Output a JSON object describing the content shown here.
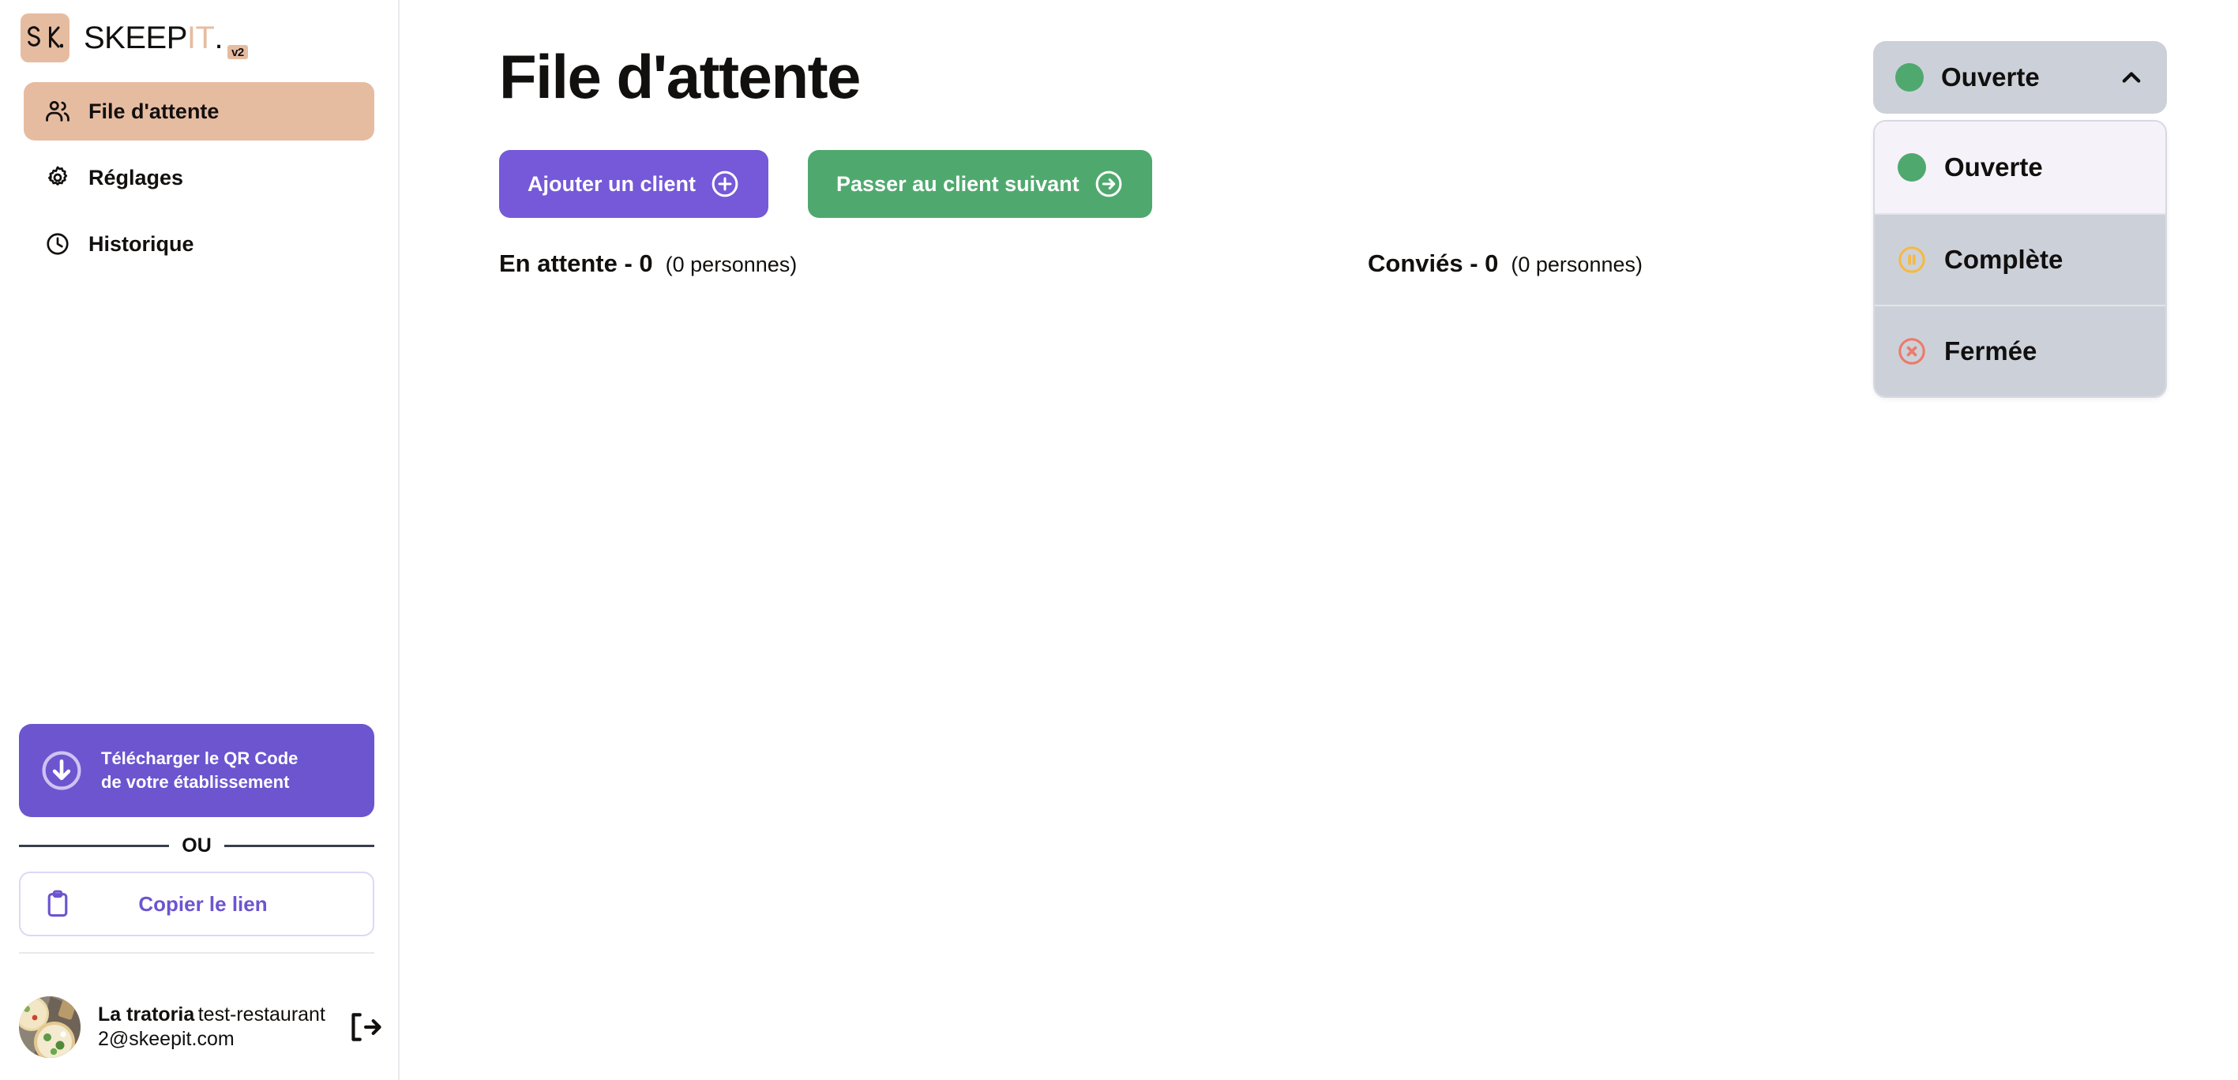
{
  "brand": {
    "mark_text": "SK.",
    "name_part1": "SKEEP",
    "name_part2": "IT",
    "name_dot": ".",
    "version_badge": "v2",
    "accent_beige": "#e6bca1",
    "accent_purple": "#6c55cf",
    "accent_green": "#4fa96e"
  },
  "sidebar": {
    "items": [
      {
        "label": "File d'attente",
        "icon": "users-icon",
        "active": true
      },
      {
        "label": "Réglages",
        "icon": "gear-icon",
        "active": false
      },
      {
        "label": "Historique",
        "icon": "clock-icon",
        "active": false
      }
    ],
    "qr_button": {
      "line1": "Télécharger le QR Code",
      "line2": "de votre établissement",
      "icon": "download-circle-icon"
    },
    "separator_label": "OU",
    "copy_button": {
      "label": "Copier le lien",
      "icon": "clipboard-icon"
    },
    "user": {
      "name": "La tratoria",
      "email": "test-restaurant2@skeepit.com",
      "logout_icon": "logout-icon",
      "avatar": "pizza-photo-avatar"
    }
  },
  "main": {
    "title": "File d'attente",
    "buttons": [
      {
        "label": "Ajouter un client",
        "icon": "plus-circle-icon",
        "color": "#7559d8"
      },
      {
        "label": "Passer au client suivant",
        "icon": "arrow-right-circle-icon",
        "color": "#4fa96e"
      }
    ],
    "counters": [
      {
        "title": "En attente - 0",
        "subtitle": "(0 personnes)"
      },
      {
        "title": "Conviés - 0",
        "subtitle": "(0 personnes)"
      }
    ]
  },
  "status": {
    "current": "Ouverte",
    "current_dot_color": "#4fa96e",
    "chevron": "chevron-up-icon",
    "expanded": true,
    "options": [
      {
        "label": "Ouverte",
        "icon": "green-dot-icon",
        "color": "#4fa96e",
        "selected": true
      },
      {
        "label": "Complète",
        "icon": "pause-circle-icon",
        "color": "#f5b945",
        "selected": false
      },
      {
        "label": "Fermée",
        "icon": "x-circle-icon",
        "color": "#ec7b6a",
        "selected": false
      }
    ]
  }
}
